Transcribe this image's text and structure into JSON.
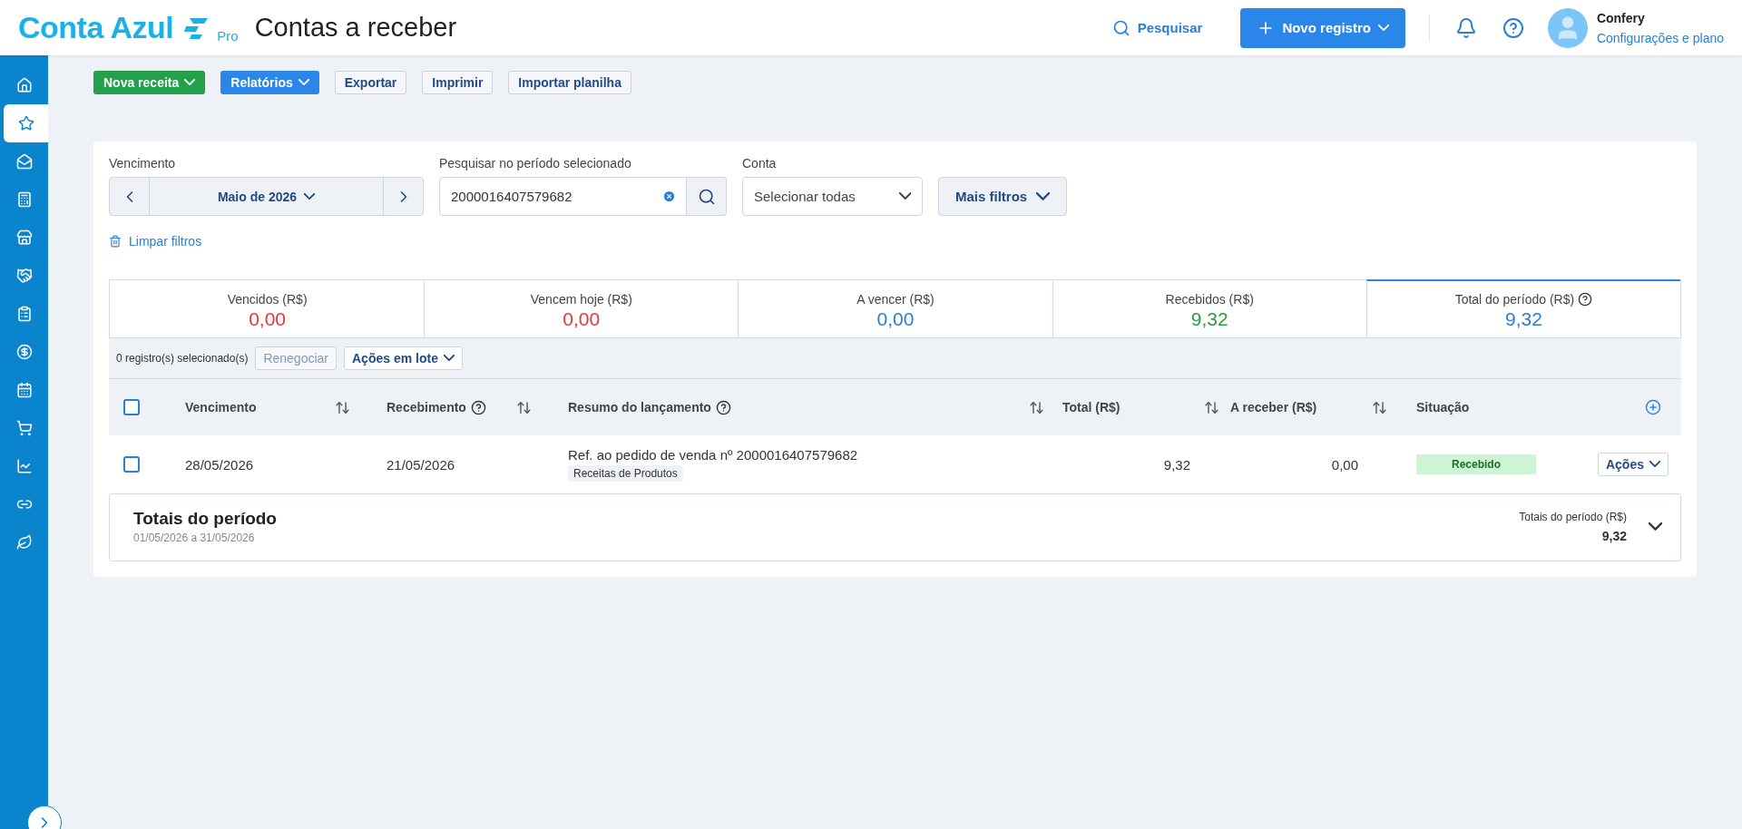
{
  "header": {
    "logo": "Conta Azul",
    "plan": "Pro",
    "title": "Contas a receber",
    "search": "Pesquisar",
    "new_button": "Novo registro",
    "user": {
      "name": "Confery",
      "link": "Configurações e plano"
    }
  },
  "sidebar": {
    "items": [
      {
        "selected": false
      },
      {
        "selected": true
      },
      {
        "selected": false
      },
      {
        "selected": false
      },
      {
        "selected": false
      },
      {
        "selected": false
      },
      {
        "selected": false
      },
      {
        "selected": false
      },
      {
        "selected": false
      },
      {
        "selected": false
      },
      {
        "selected": false
      },
      {
        "selected": false
      },
      {
        "selected": false
      }
    ]
  },
  "toolbar": [
    {
      "label": "Nova receita",
      "kind": "green"
    },
    {
      "label": "Relatórios",
      "kind": "blue"
    },
    {
      "label": "Exportar",
      "kind": "plain"
    },
    {
      "label": "Imprimir",
      "kind": "plain"
    },
    {
      "label": "Importar planilha",
      "kind": "plain"
    }
  ],
  "filters": {
    "due_label": "Vencimento",
    "period": "Maio de 2026",
    "search_label": "Pesquisar no período selecionado",
    "search_value": "2000016407579682",
    "account_label": "Conta",
    "account_value": "Selecionar todas",
    "more": "Mais filtros",
    "clear": "Limpar filtros"
  },
  "summary": [
    {
      "label": "Vencidos (R$)",
      "value": "0,00",
      "color": "#e53935",
      "selected": false,
      "help": false
    },
    {
      "label": "Vencem hoje (R$)",
      "value": "0,00",
      "color": "#e53935",
      "selected": false,
      "help": false
    },
    {
      "label": "A vencer (R$)",
      "value": "0,00",
      "color": "#2a7fd4",
      "selected": false,
      "help": false
    },
    {
      "label": "Recebidos (R$)",
      "value": "9,32",
      "color": "#2e9e3e",
      "selected": false,
      "help": false
    },
    {
      "label": "Total do período (R$)",
      "value": "9,32",
      "color": "#2a7fd4",
      "selected": true,
      "help": true
    }
  ],
  "selection": {
    "count": "0 registro(s) selecionado(s)",
    "renegotiate": "Renegociar",
    "bulk": "Ações em lote"
  },
  "table": {
    "header_checked": false,
    "columns": [
      {
        "label": "Vencimento",
        "help": false,
        "sortable": true
      },
      {
        "label": "Recebimento",
        "help": true,
        "sortable": true
      },
      {
        "label": "Resumo do lançamento",
        "help": true,
        "sortable": true
      },
      {
        "label": "Total (R$)",
        "help": false,
        "sortable": true
      },
      {
        "label": "A receber (R$)",
        "help": false,
        "sortable": true
      },
      {
        "label": "Situação",
        "help": false,
        "sortable": false
      }
    ],
    "rows": [
      {
        "checked": false,
        "due": "28/05/2026",
        "received": "21/05/2026",
        "summary": "Ref. ao pedido de venda nº 2000016407579682",
        "category": "Receitas de Produtos",
        "total": "9,32",
        "to_receive": "0,00",
        "status": "Recebido",
        "actions": "Ações"
      }
    ]
  },
  "totals": {
    "title": "Totais do período",
    "range": "01/05/2026 a 31/05/2026",
    "label": "Totais do período (R$)",
    "value": "9,32",
    "expanded": false
  }
}
